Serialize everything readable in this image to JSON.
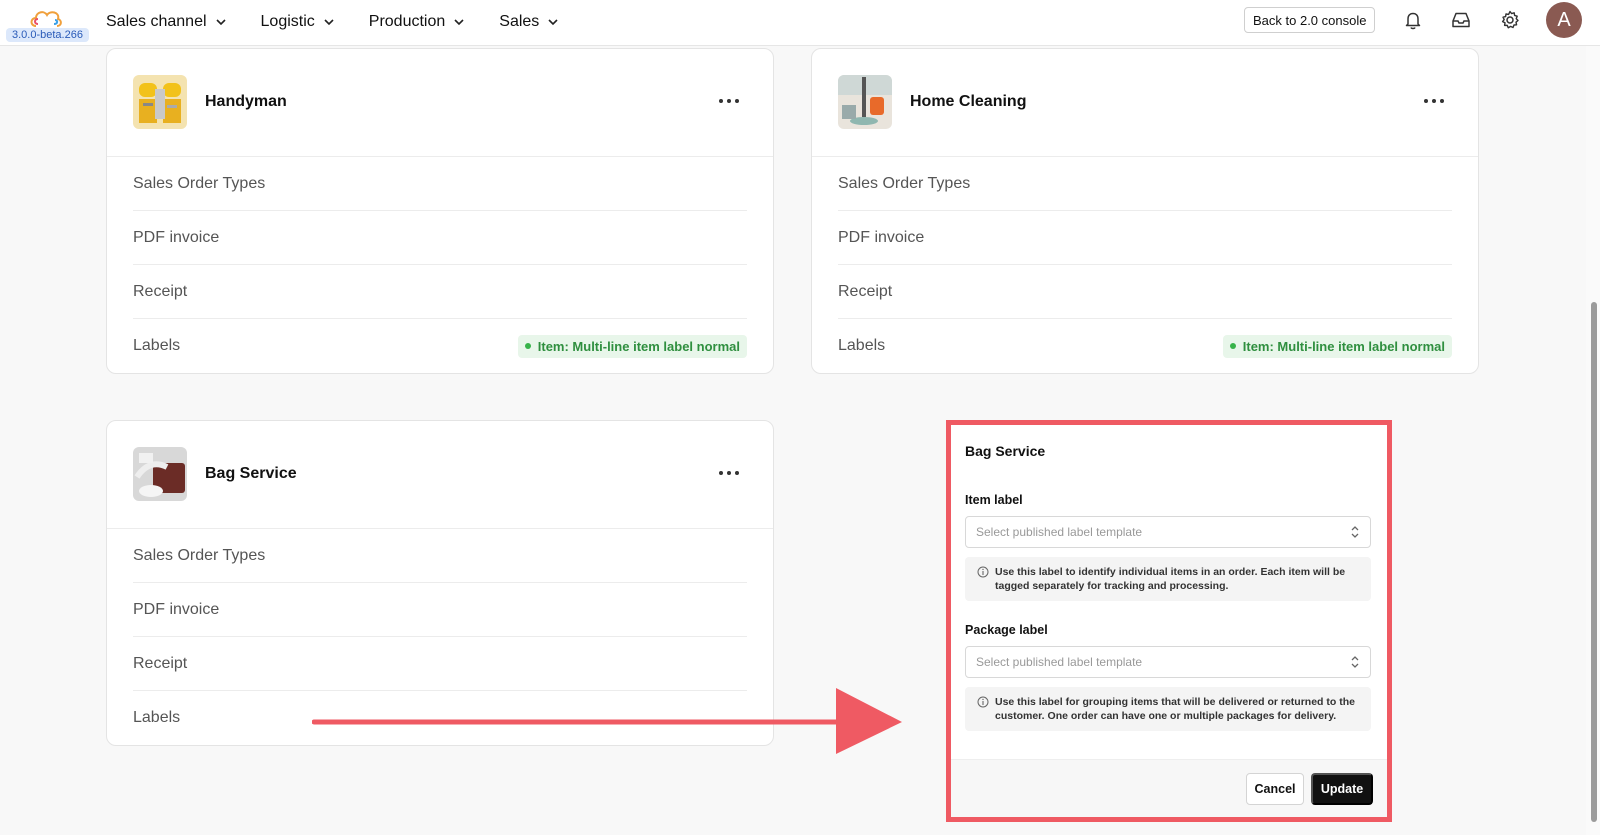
{
  "header": {
    "version": "3.0.0-beta.266",
    "nav": [
      {
        "label": "Sales channel"
      },
      {
        "label": "Logistic"
      },
      {
        "label": "Production"
      },
      {
        "label": "Sales"
      }
    ],
    "back_button": "Back to 2.0 console",
    "avatar_initial": "A",
    "icons": [
      "bell-icon",
      "inbox-icon",
      "gear-icon"
    ]
  },
  "cards": [
    {
      "title": "Handyman",
      "rows": [
        {
          "label": "Sales Order Types",
          "badge": ""
        },
        {
          "label": "PDF invoice",
          "badge": ""
        },
        {
          "label": "Receipt",
          "badge": ""
        },
        {
          "label": "Labels",
          "badge": "Item: Multi-line item label normal"
        }
      ]
    },
    {
      "title": "Home Cleaning",
      "rows": [
        {
          "label": "Sales Order Types",
          "badge": ""
        },
        {
          "label": "PDF invoice",
          "badge": ""
        },
        {
          "label": "Receipt",
          "badge": ""
        },
        {
          "label": "Labels",
          "badge": "Item: Multi-line item label normal"
        }
      ]
    },
    {
      "title": "Bag Service",
      "rows": [
        {
          "label": "Sales Order Types",
          "badge": ""
        },
        {
          "label": "PDF invoice",
          "badge": ""
        },
        {
          "label": "Receipt",
          "badge": ""
        },
        {
          "label": "Labels",
          "badge": ""
        }
      ]
    }
  ],
  "dialog": {
    "title": "Bag Service",
    "item_label": {
      "label": "Item label",
      "placeholder": "Select published label template",
      "info": "Use this label to identify individual items in an order. Each item will be tagged separately for tracking and processing."
    },
    "package_label": {
      "label": "Package label",
      "placeholder": "Select published label template",
      "info": "Use this label for grouping items that will be delivered or returned to the customer. One order can have one or multiple packages for delivery."
    },
    "cancel_label": "Cancel",
    "update_label": "Update"
  },
  "colors": {
    "highlight": "#ef5a63",
    "badge_text": "#2f8f3f",
    "badge_bg": "#e8f6ea",
    "primary_button": "#111111"
  }
}
